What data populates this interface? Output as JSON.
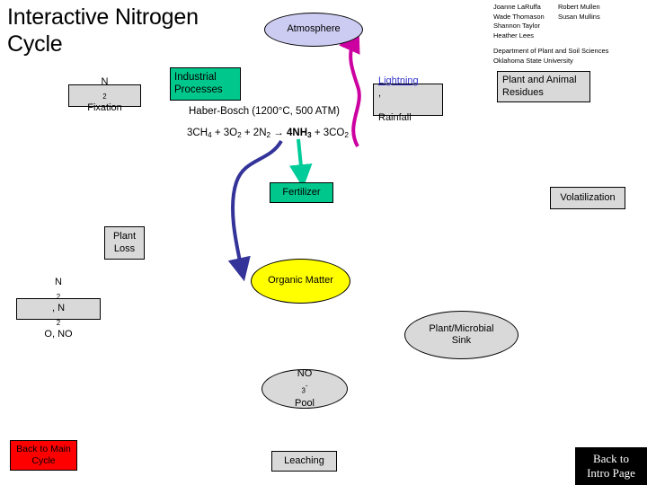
{
  "title": "Interactive Nitrogen\nCycle",
  "credits": {
    "column_a": "Joanne LaRuffa\nWade Thomason\nShannon Taylor\nHeather Lees",
    "column_b": "Robert Mullen\nSusan Mullins",
    "department": "Department of Plant and Soil Sciences\nOklahoma State University"
  },
  "nodes": {
    "atmosphere": "Atmosphere",
    "n2_fixation_pre": "N",
    "n2_fixation_sub": "2",
    "n2_fixation_post": " Fixation",
    "industrial_processes": "Industrial\nProcesses",
    "lightning_link": "Lightning",
    "lightning_comma": ",",
    "rainfall": "Rainfall",
    "plant_and_animal_residues": "Plant and Animal\nResidues",
    "fertilizer": "Fertilizer",
    "volatilization": "Volatilization",
    "plant_loss": "Plant\nLoss",
    "organic_matter": "Organic Matter",
    "n2_n2o_no_a": "N",
    "n2_n2o_no_b": "2",
    "n2_n2o_no_c": ", N",
    "n2_n2o_no_d": "2",
    "n2_n2o_no_e": "O, NO",
    "plant_microbial_sink": "Plant/Microbial\nSink",
    "no3_pool_a": "NO",
    "no3_pool_sub": "3",
    "no3_pool_sup": "-",
    "no3_pool_b": " Pool",
    "leaching": "Leaching"
  },
  "formula": {
    "haber_conditions": "Haber-Bosch (1200°C, 500 ATM)",
    "equation_a": "3CH",
    "equation_a_sub": "4",
    "equation_b": " + 3O",
    "equation_b_sub": "2",
    "equation_c": " + 2N",
    "equation_c_sub": "2",
    "equation_arrow": " → ",
    "equation_d": "4NH",
    "equation_d_sub": "3",
    "equation_e": " + 3CO",
    "equation_e_sub": "2"
  },
  "buttons": {
    "back_to_main_cycle": "Back to Main\nCycle",
    "back_to_intro_page": "Back to\nIntro Page"
  },
  "colors": {
    "atmosphere_fill": "#ccccf2",
    "box_fill": "#d9d9d9",
    "green_fill": "#00c88c",
    "yellow_fill": "#ffff00",
    "red_fill": "#ff0000",
    "black_fill": "#000000",
    "link_blue": "#3333cc",
    "arrow_magenta": "#cc00a0",
    "arrow_blue": "#333399",
    "arrow_teal": "#00cc99"
  }
}
